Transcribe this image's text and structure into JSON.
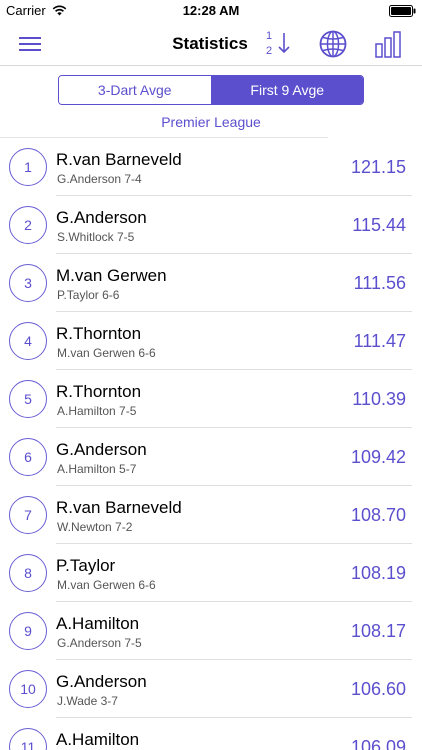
{
  "status": {
    "carrier": "Carrier",
    "time": "12:28 AM"
  },
  "nav": {
    "title": "Statistics",
    "sort_top": "1",
    "sort_bottom": "2"
  },
  "tabs": [
    {
      "label": "3-Dart Avge",
      "selected": false
    },
    {
      "label": "First 9 Avge",
      "selected": true
    }
  ],
  "league": "Premier League",
  "colors": {
    "accent": "#5b4fce"
  },
  "rows": [
    {
      "rank": "1",
      "player": "R.van Barneveld",
      "match": "G.Anderson 7-4",
      "score": "121.15"
    },
    {
      "rank": "2",
      "player": "G.Anderson",
      "match": "S.Whitlock 7-5",
      "score": "115.44"
    },
    {
      "rank": "3",
      "player": "M.van Gerwen",
      "match": "P.Taylor 6-6",
      "score": "111.56"
    },
    {
      "rank": "4",
      "player": "R.Thornton",
      "match": "M.van Gerwen 6-6",
      "score": "111.47"
    },
    {
      "rank": "5",
      "player": "R.Thornton",
      "match": "A.Hamilton 7-5",
      "score": "110.39"
    },
    {
      "rank": "6",
      "player": "G.Anderson",
      "match": "A.Hamilton 5-7",
      "score": "109.42"
    },
    {
      "rank": "7",
      "player": "R.van Barneveld",
      "match": "W.Newton 7-2",
      "score": "108.70"
    },
    {
      "rank": "8",
      "player": "P.Taylor",
      "match": "M.van Gerwen 6-6",
      "score": "108.19"
    },
    {
      "rank": "9",
      "player": "A.Hamilton",
      "match": "G.Anderson 7-5",
      "score": "108.17"
    },
    {
      "rank": "10",
      "player": "G.Anderson",
      "match": "J.Wade 3-7",
      "score": "106.60"
    },
    {
      "rank": "11",
      "player": "A.Hamilton",
      "match": "",
      "score": "106.09"
    }
  ]
}
